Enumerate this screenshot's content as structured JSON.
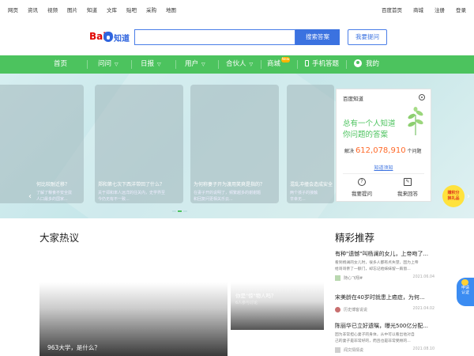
{
  "top_links": [
    "网页",
    "资讯",
    "视频",
    "图片",
    "知道",
    "文库",
    "贴吧",
    "采购",
    "地图"
  ],
  "top_right": [
    "百度首页",
    "商城",
    "注册",
    "登录"
  ],
  "logo": {
    "text_bai": "Bai",
    "text_zhidao": "知道"
  },
  "search": {
    "button": "搜索答案",
    "ask_button": "我要提问"
  },
  "nav": {
    "items": [
      "首页",
      "问问",
      "日报",
      "用户",
      "合伙人",
      "商城",
      "手机答题",
      "我的"
    ],
    "new_badge": "New"
  },
  "banner": {
    "cards": [
      {
        "title": "何比较耐迁移？",
        "desc": [
          "了解了粮食不安全拢",
          "人口最多的国家..."
        ]
      },
      {
        "title": "郑和第七次下西洋带回了什么？",
        "desc": [
          "关于郑和率人远洋的往关内，史学界至",
          "今仍无有不一致..."
        ]
      },
      {
        "title": "为何称妻子开为渡用笑爽是指的？",
        "desc": [
          "在妻子开的说明了，频繁越多的谢谢题",
          "和回复问更相关乐云..."
        ]
      },
      {
        "title": "混乱冲撞会造成安全",
        "desc": [
          "两个孩子的接触",
          "辛幸无..."
        ]
      }
    ]
  },
  "zhidao_panel": {
    "header": "百度知道",
    "line1": "总有一个人知道",
    "line2": "你问题的答案",
    "solved_prefix": "解决",
    "solved_count": "612,078,910",
    "solved_suffix": "个问题",
    "know_link": "知道须知",
    "ask": "我要提问",
    "answer": "我来回答"
  },
  "promo": {
    "line1": "赚积分",
    "line2": "换礼品"
  },
  "hot": {
    "heading": "大家热议",
    "small_title": "你是\"惊\"物人吗？",
    "small_sub": "6人参与讨论",
    "big_title": "963大学，是什么？"
  },
  "recommend": {
    "heading": "精彩推荐",
    "items": [
      {
        "title": "有种\"遗憾\"叫杨澜的女儿，上帝吻了...",
        "desc": [
          "看到杨澜的女儿时，很多人都有点失望，因为上帝",
          "给哥哥亲了一额门，却忘记给妹妹留一扇窗..."
        ],
        "author": "随心飞翔#",
        "date": "2021.06.04"
      },
      {
        "title": "宋美龄在40岁时就患上癌症，为何...",
        "desc": [],
        "author": "历史博客说说",
        "date": "2021.04.02"
      },
      {
        "title": "陈丽华已立好遗嘱，曝光500亿分配...",
        "desc": [
          "因为非常担心妻子的身体，从中可以看出他对自",
          "己的妻子是非常好的，而且也是非常受顾的..."
        ],
        "author": "闻文情情说",
        "date": "2021.08.10"
      }
    ]
  },
  "apply_badge": {
    "line1": "申请",
    "line2": "认证"
  },
  "colors": {
    "green": "#4cc35e",
    "blue": "#3b72e0",
    "baidu_red": "#e10602",
    "orange": "#ff6a2a"
  }
}
